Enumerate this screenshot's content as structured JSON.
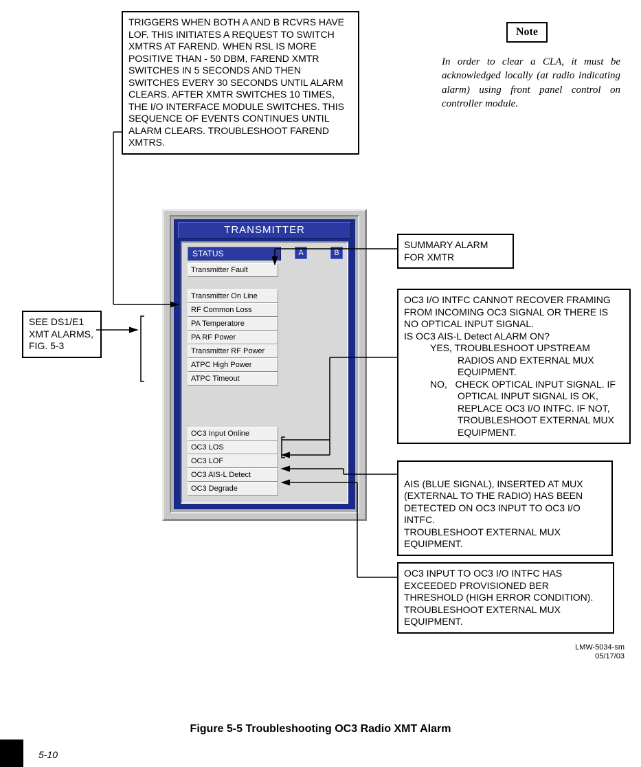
{
  "notes": {
    "triggers": "TRIGGERS WHEN BOTH A AND B RCVRS HAVE LOF. THIS INITIATES A REQUEST TO SWITCH XMTRS AT FAREND. WHEN RSL IS MORE POSITIVE THAN - 50 DBM, FAREND XMTR SWITCHES IN 5 SECONDS AND THEN SWITCHES EVERY 30 SECONDS UNTIL ALARM CLEARS. AFTER XMTR SWITCHES 10 TIMES, THE I/O INTERFACE MODULE SWITCHES. THIS SEQUENCE OF EVENTS CONTINUES UNTIL ALARM CLEARS. TROUBLESHOOT FAREND XMTRS.",
    "summary_alarm": "SUMMARY ALARM FOR XMTR",
    "see_ds1": "SEE DS1/E1 XMT ALARMS, FIG. 5-3",
    "oc3_intfc_intro": "OC3 I/O INTFC CANNOT RECOVER FRAMING FROM INCOMING OC3 SIGNAL OR THERE IS NO OPTICAL INPUT SIGNAL.",
    "oc3_intfc_q": "IS OC3 AIS-L Detect ALARM ON?",
    "oc3_intfc_yes": "YES, TROUBLESHOOT UPSTREAM RADIOS AND EXTERNAL MUX EQUIPMENT.",
    "oc3_intfc_no": "NO,   CHECK OPTICAL INPUT SIGNAL. IF OPTICAL INPUT SIGNAL IS OK, REPLACE OC3 I/O INTFC. IF NOT, TROUBLESHOOT EXTERNAL MUX EQUIPMENT.",
    "ais_blue": "AIS (BLUE SIGNAL), INSERTED AT MUX (EXTERNAL TO THE RADIO) HAS BEEN DETECTED ON OC3 INPUT TO OC3 I/O INTFC.\nTROUBLESHOOT EXTERNAL MUX EQUIPMENT.",
    "oc3_ber": "OC3 INPUT TO OC3 I/O INTFC HAS EXCEEDED PROVISIONED BER THRESHOLD (HIGH ERROR CONDITION). TROUBLESHOOT EXTERNAL MUX EQUIPMENT."
  },
  "note_label": "Note",
  "note_body": "In order to clear a CLA, it must be acknowledged locally (at radio indicating alarm) using front panel control on controller module.",
  "panel": {
    "title": "TRANSMITTER",
    "status": "STATUS",
    "badge_a": "A",
    "badge_b": "B",
    "rows": {
      "r1": "Transmitter Fault",
      "r2": "Transmitter On Line",
      "r3": "RF Common Loss",
      "r4": "PA Temperatore",
      "r5": "PA RF Power",
      "r6": "Transmitter RF Power",
      "r7": "ATPC High Power",
      "r8": "ATPC Timeout",
      "r9": "OC3 Input Online",
      "r10": "OC3 LOS",
      "r11": "OC3 LOF",
      "r12": "OC3 AIS-L Detect",
      "r13": "OC3 Degrade"
    }
  },
  "docid1": "LMW-5034-sm",
  "docid2": "05/17/03",
  "figure_caption": "Figure 5-5  Troubleshooting OC3 Radio XMT Alarm",
  "page_num": "5-10"
}
